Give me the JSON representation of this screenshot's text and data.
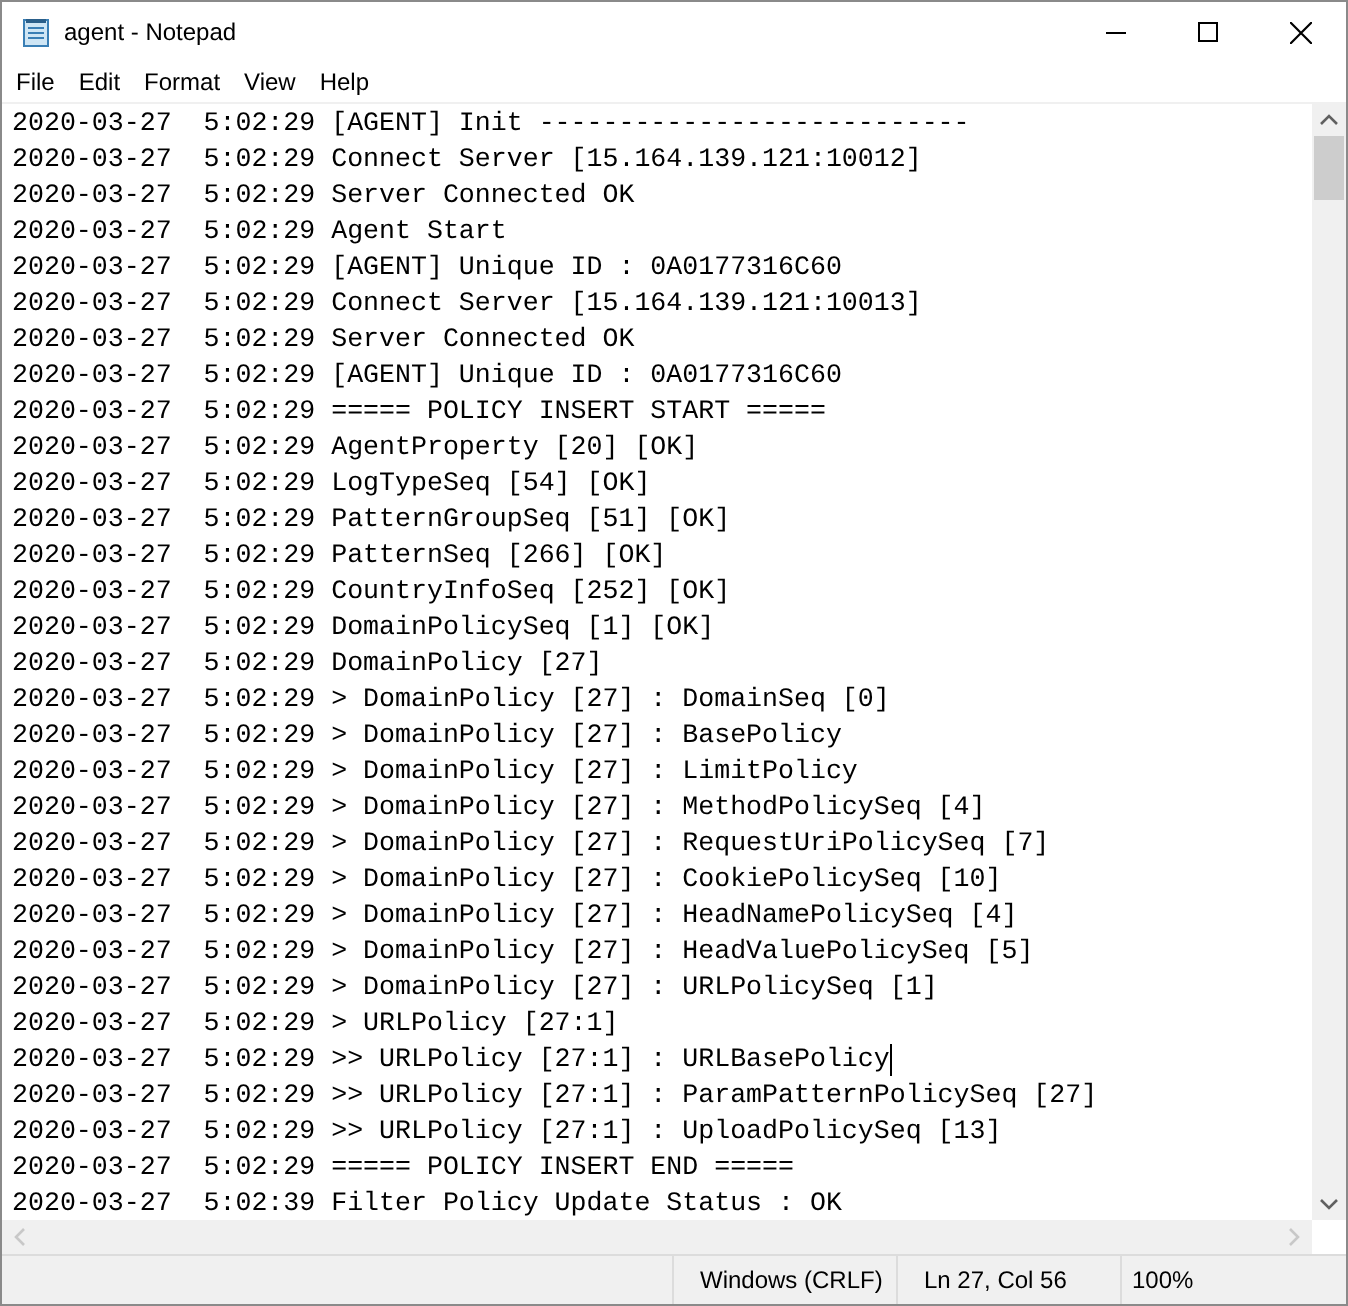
{
  "window": {
    "title": "agent - Notepad"
  },
  "menu": [
    "File",
    "Edit",
    "Format",
    "View",
    "Help"
  ],
  "lines": [
    {
      "text": "2020-03-27  5:02:29 [AGENT] Init ---------------------------",
      "caret": false
    },
    {
      "text": "2020-03-27  5:02:29 Connect Server [15.164.139.121:10012]",
      "caret": false
    },
    {
      "text": "2020-03-27  5:02:29 Server Connected OK",
      "caret": false
    },
    {
      "text": "2020-03-27  5:02:29 Agent Start",
      "caret": false
    },
    {
      "text": "2020-03-27  5:02:29 [AGENT] Unique ID : 0A0177316C60",
      "caret": false
    },
    {
      "text": "2020-03-27  5:02:29 Connect Server [15.164.139.121:10013]",
      "caret": false
    },
    {
      "text": "2020-03-27  5:02:29 Server Connected OK",
      "caret": false
    },
    {
      "text": "2020-03-27  5:02:29 [AGENT] Unique ID : 0A0177316C60",
      "caret": false
    },
    {
      "text": "2020-03-27  5:02:29 ===== POLICY INSERT START =====",
      "caret": false
    },
    {
      "text": "2020-03-27  5:02:29 AgentProperty [20] [OK]",
      "caret": false
    },
    {
      "text": "2020-03-27  5:02:29 LogTypeSeq [54] [OK]",
      "caret": false
    },
    {
      "text": "2020-03-27  5:02:29 PatternGroupSeq [51] [OK]",
      "caret": false
    },
    {
      "text": "2020-03-27  5:02:29 PatternSeq [266] [OK]",
      "caret": false
    },
    {
      "text": "2020-03-27  5:02:29 CountryInfoSeq [252] [OK]",
      "caret": false
    },
    {
      "text": "2020-03-27  5:02:29 DomainPolicySeq [1] [OK]",
      "caret": false
    },
    {
      "text": "2020-03-27  5:02:29 DomainPolicy [27]",
      "caret": false
    },
    {
      "text": "2020-03-27  5:02:29 > DomainPolicy [27] : DomainSeq [0]",
      "caret": false
    },
    {
      "text": "2020-03-27  5:02:29 > DomainPolicy [27] : BasePolicy",
      "caret": false
    },
    {
      "text": "2020-03-27  5:02:29 > DomainPolicy [27] : LimitPolicy",
      "caret": false
    },
    {
      "text": "2020-03-27  5:02:29 > DomainPolicy [27] : MethodPolicySeq [4]",
      "caret": false
    },
    {
      "text": "2020-03-27  5:02:29 > DomainPolicy [27] : RequestUriPolicySeq [7]",
      "caret": false
    },
    {
      "text": "2020-03-27  5:02:29 > DomainPolicy [27] : CookiePolicySeq [10]",
      "caret": false
    },
    {
      "text": "2020-03-27  5:02:29 > DomainPolicy [27] : HeadNamePolicySeq [4]",
      "caret": false
    },
    {
      "text": "2020-03-27  5:02:29 > DomainPolicy [27] : HeadValuePolicySeq [5]",
      "caret": false
    },
    {
      "text": "2020-03-27  5:02:29 > DomainPolicy [27] : URLPolicySeq [1]",
      "caret": false
    },
    {
      "text": "2020-03-27  5:02:29 > URLPolicy [27:1]",
      "caret": false
    },
    {
      "text": "2020-03-27  5:02:29 >> URLPolicy [27:1] : URLBasePolicy",
      "caret": true
    },
    {
      "text": "2020-03-27  5:02:29 >> URLPolicy [27:1] : ParamPatternPolicySeq [27]",
      "caret": false
    },
    {
      "text": "2020-03-27  5:02:29 >> URLPolicy [27:1] : UploadPolicySeq [13]",
      "caret": false
    },
    {
      "text": "2020-03-27  5:02:29 ===== POLICY INSERT END =====",
      "caret": false
    },
    {
      "text": "2020-03-27  5:02:39 Filter Policy Update Status : OK",
      "caret": false
    }
  ],
  "status_bar": {
    "line_ending": "Windows (CRLF)",
    "position": "Ln 27, Col 56",
    "zoom": "100%"
  }
}
